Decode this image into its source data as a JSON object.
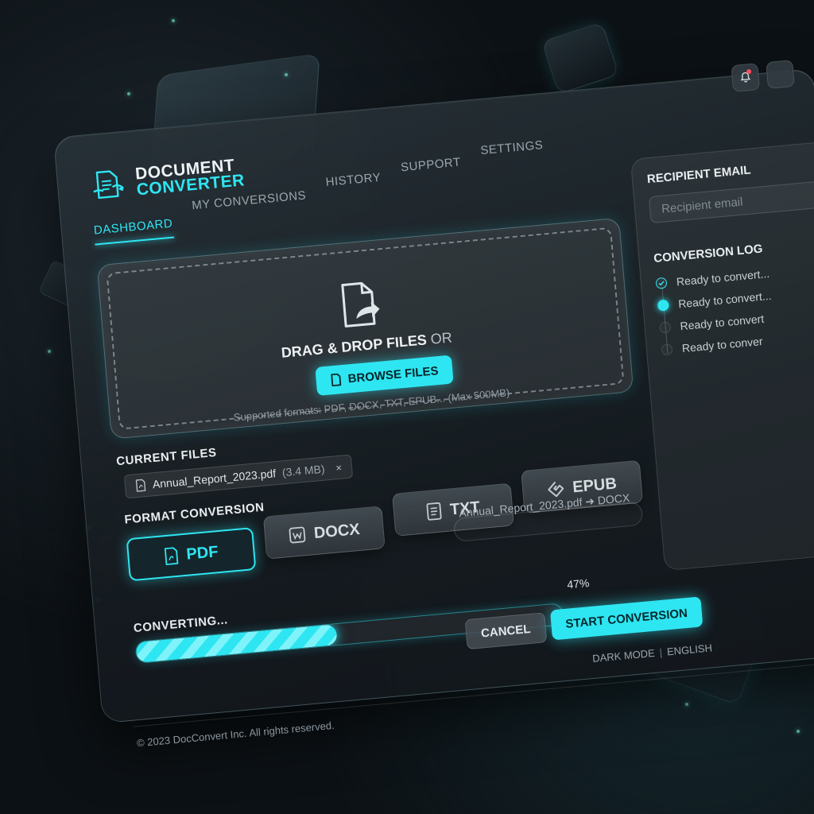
{
  "app": {
    "title_line1": "DOCUMENT",
    "title_line2": "CONVERTER"
  },
  "nav": {
    "items": [
      "DASHBOARD",
      "MY CONVERSIONS",
      "HISTORY",
      "SUPPORT",
      "SETTINGS"
    ],
    "active": "DASHBOARD"
  },
  "dropzone": {
    "title": "DRAG & DROP FILES",
    "or": "OR",
    "browse_label": "BROWSE FILES",
    "hint": "Supported formats: PDF, DOCX, TXT, EPUB... (Max 500MB)"
  },
  "current_files": {
    "label": "CURRENT FILES",
    "files": [
      {
        "name": "Annual_Report_2023.pdf",
        "size": "(3.4 MB)",
        "remove": "×"
      }
    ]
  },
  "format_conversion": {
    "label": "FORMAT CONVERSION",
    "formats": [
      "PDF",
      "DOCX",
      "TXT",
      "EPUB"
    ],
    "selected": "PDF",
    "summary": "Annual_Report_2023.pdf ➜ DOCX"
  },
  "progress": {
    "label": "CONVERTING...",
    "percent_text": "47%",
    "value": 0.47
  },
  "actions": {
    "cancel_label": "CANCEL",
    "start_label": "START CONVERSION"
  },
  "right_panel": {
    "recipient_title": "RECIPIENT EMAIL",
    "recipient_placeholder": "Recipient email",
    "log_title": "CONVERSION LOG",
    "log_items": [
      "Ready to convert...",
      "Ready to convert...",
      "Ready to convert",
      "Ready to conver"
    ]
  },
  "footer": {
    "dark_mode": "DARK MODE",
    "separator": "|",
    "language": "ENGLISH",
    "copyright": "© 2023 DocConvert Inc. All rights reserved."
  },
  "colors": {
    "accent": "#2ee6f2",
    "background": "#0c1115",
    "notification": "#ff4a5a"
  },
  "icons": {
    "logo": "document-convert-icon",
    "notifications": "bell-icon",
    "upload": "file-share-icon",
    "browse": "file-icon",
    "file": "pdf-file-icon",
    "pdf": "pdf-icon",
    "docx": "word-icon",
    "txt": "text-file-icon",
    "epub": "epub-icon"
  }
}
